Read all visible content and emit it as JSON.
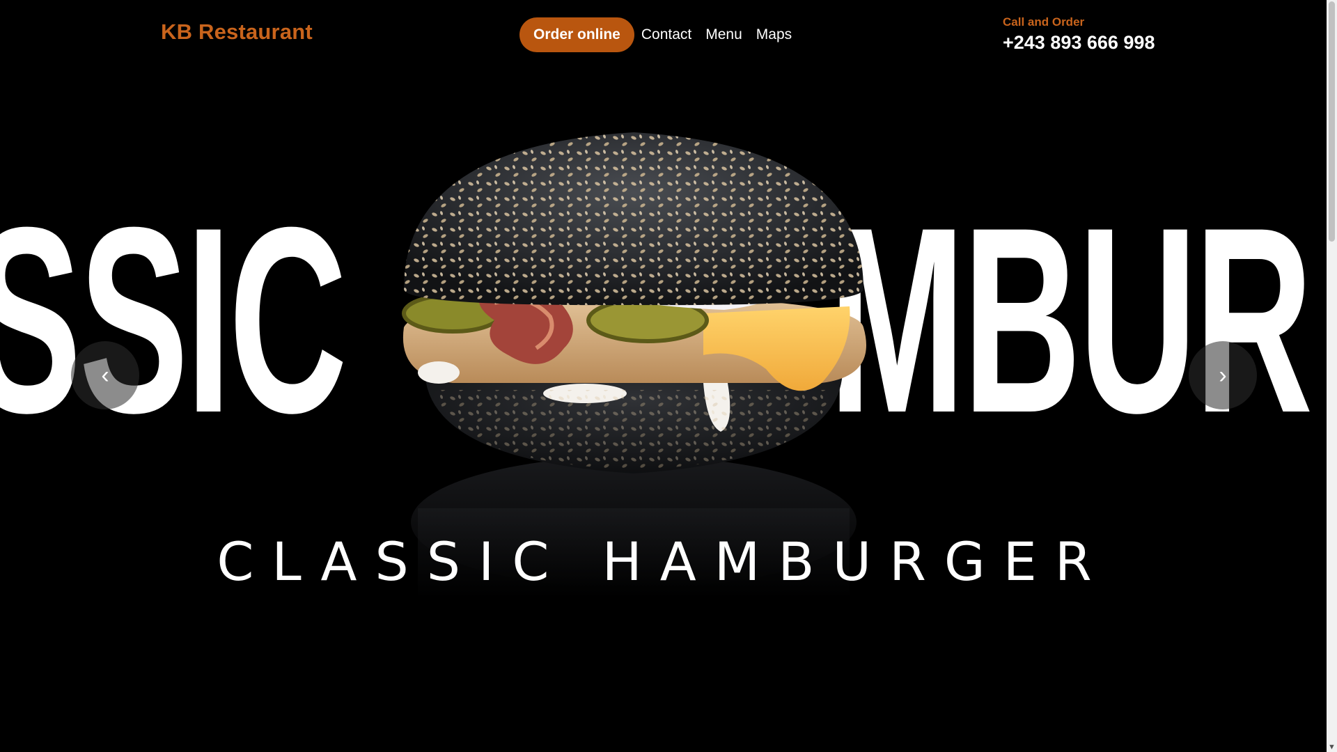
{
  "header": {
    "brand": "KB Restaurant",
    "order_button": "Order online",
    "nav": [
      "Contact",
      "Menu",
      "Maps"
    ],
    "contact_label": "Call and Order",
    "phone": "+243 893 666 998"
  },
  "hero": {
    "giant_left": "SSIC",
    "giant_right": "MBUR",
    "title": "CLASSIC HAMBURGER",
    "prev_icon": "chevron-left-icon",
    "next_icon": "chevron-right-icon"
  },
  "colors": {
    "accent": "#c9641c",
    "button": "#b9560f",
    "background": "#000000",
    "text": "#ffffff"
  }
}
